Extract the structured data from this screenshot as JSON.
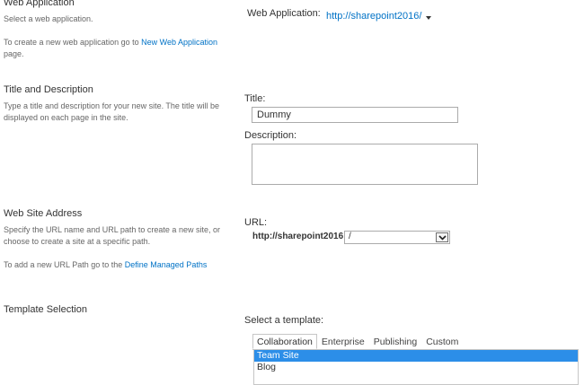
{
  "web_application": {
    "title": "Web Application",
    "desc1": "Select a web application.",
    "desc2_pre": "To create a new web application go to ",
    "desc2_link": "New Web Application",
    "desc2_post": " page.",
    "field_label": "Web Application:",
    "value": "http://sharepoint2016/"
  },
  "title_description": {
    "title": "Title and Description",
    "desc": "Type a title and description for your new site. The title will be displayed on each page in the site.",
    "title_label": "Title:",
    "title_value": "Dummy",
    "description_label": "Description:",
    "description_value": ""
  },
  "web_site_address": {
    "title": "Web Site Address",
    "desc1": "Specify the URL name and URL path to create a new site, or choose to create a site at a specific path.",
    "desc2_pre": "To add a new URL Path go to the ",
    "desc2_link": "Define Managed Paths",
    "url_label": "URL:",
    "url_prefix": "http://sharepoint2016",
    "path_value": "/"
  },
  "template_selection": {
    "title": "Template Selection",
    "select_label": "Select a template:",
    "tabs": [
      "Collaboration",
      "Enterprise",
      "Publishing",
      "Custom"
    ],
    "active_tab": "Collaboration",
    "templates": [
      "Team Site",
      "Blog"
    ],
    "selected_template": "Team Site"
  },
  "colors": {
    "link": "#0072c6",
    "selection": "#2c8ee8"
  }
}
